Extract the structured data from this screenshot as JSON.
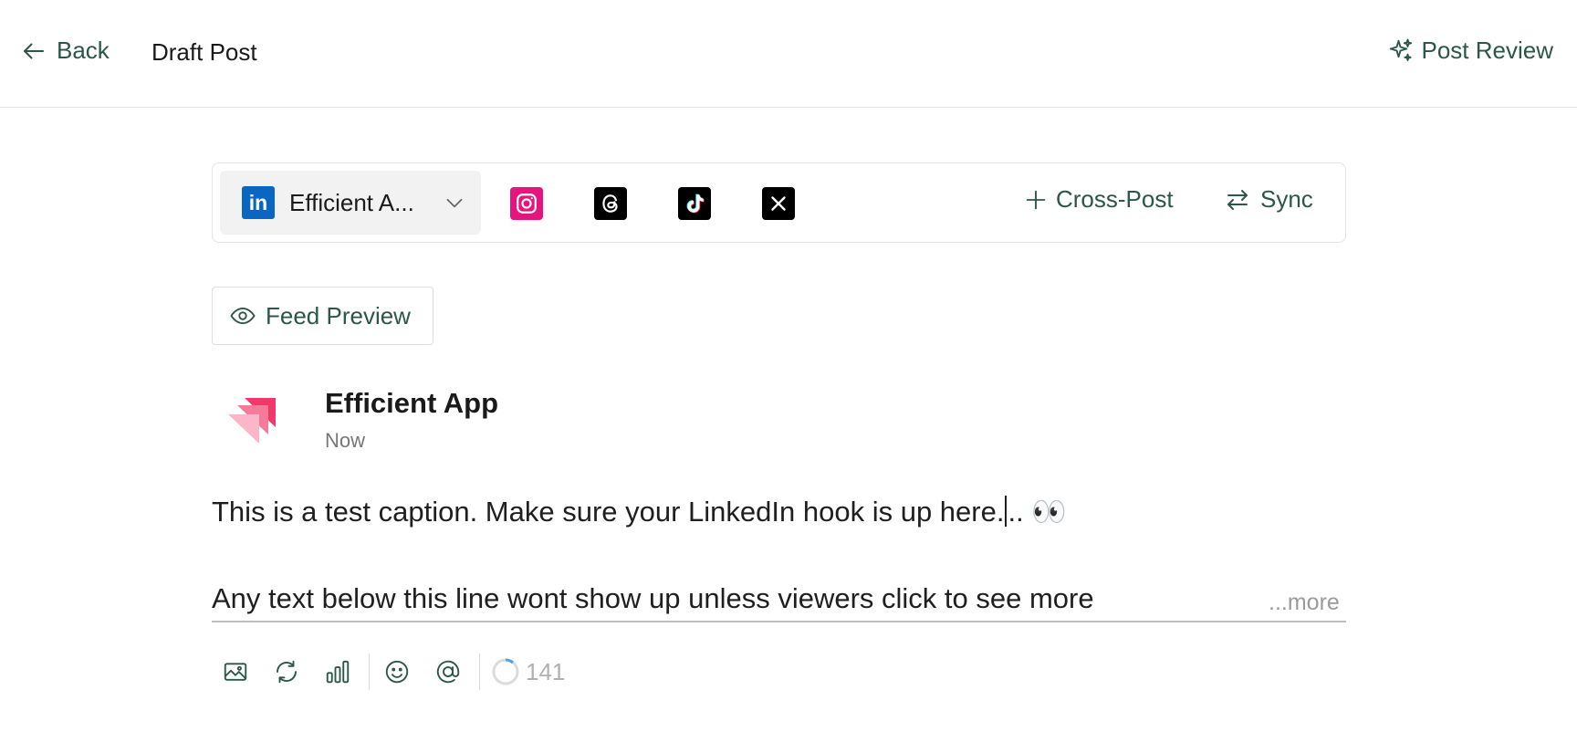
{
  "header": {
    "back_label": "Back",
    "title": "Draft Post",
    "post_review_label": "Post Review"
  },
  "platform_bar": {
    "selected_account": "Efficient A...",
    "platforms": [
      {
        "name": "instagram",
        "icon": "instagram-icon",
        "color": "#e4157f"
      },
      {
        "name": "threads",
        "icon": "threads-icon",
        "color": "#000000"
      },
      {
        "name": "tiktok",
        "icon": "tiktok-icon",
        "color": "#000000"
      },
      {
        "name": "x",
        "icon": "x-icon",
        "color": "#000000"
      }
    ],
    "linkedin_badge": "in",
    "cross_post_label": "Cross-Post",
    "sync_label": "Sync"
  },
  "feed_preview": {
    "label": "Feed Preview"
  },
  "post": {
    "author": "Efficient App",
    "time": "Now",
    "caption_line1_before_caret": "This is a test caption. Make sure your LinkedIn hook is up here.",
    "caption_line1_after_caret": ".. 👀",
    "caption_line2": "Any text below this line wont show up unless viewers click to see more",
    "more_label": "...more"
  },
  "toolbar": {
    "char_count": "141"
  },
  "colors": {
    "accent": "#2b5747",
    "linkedin": "#0a66c2",
    "logo_pink": "#f0386b"
  }
}
